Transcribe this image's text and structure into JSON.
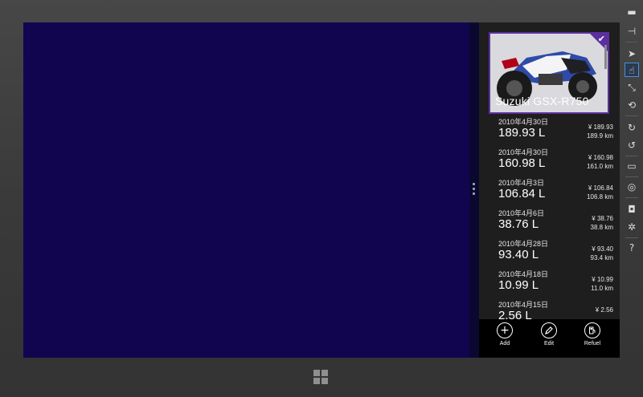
{
  "vehicle": {
    "name": "Suzuki GSX-R750",
    "selected": true
  },
  "entries": [
    {
      "date": "2010年4月30日",
      "amount": "189.93 L",
      "price": "¥ 189.93",
      "distance": "189.9 km"
    },
    {
      "date": "2010年4月30日",
      "amount": "160.98 L",
      "price": "¥ 160.98",
      "distance": "161.0 km"
    },
    {
      "date": "2010年4月3日",
      "amount": "106.84 L",
      "price": "¥ 106.84",
      "distance": "106.8 km"
    },
    {
      "date": "2010年4月6日",
      "amount": "38.76 L",
      "price": "¥ 38.76",
      "distance": "38.8 km"
    },
    {
      "date": "2010年4月28日",
      "amount": "93.40 L",
      "price": "¥ 93.40",
      "distance": "93.4 km"
    },
    {
      "date": "2010年4月18日",
      "amount": "10.99 L",
      "price": "¥ 10.99",
      "distance": "11.0 km"
    },
    {
      "date": "2010年4月15日",
      "amount": "2.56 L",
      "price": "¥ 2.56",
      "distance": ""
    }
  ],
  "appbar": {
    "add_label": "Add",
    "edit_label": "Edit",
    "refuel_label": "Refuel"
  },
  "colors": {
    "main_background": "#120550",
    "accent": "#5b2fa0",
    "panel_background": "#1e1e1e"
  },
  "sidebar_tools": [
    "minimize-icon",
    "pin-icon",
    "pointer-icon",
    "touch-icon",
    "pinch-icon",
    "zoom-icon",
    "rotate-cw-icon",
    "rotate-ccw-icon",
    "resolution-icon",
    "location-icon",
    "camera-icon",
    "settings-icon",
    "help-icon"
  ]
}
